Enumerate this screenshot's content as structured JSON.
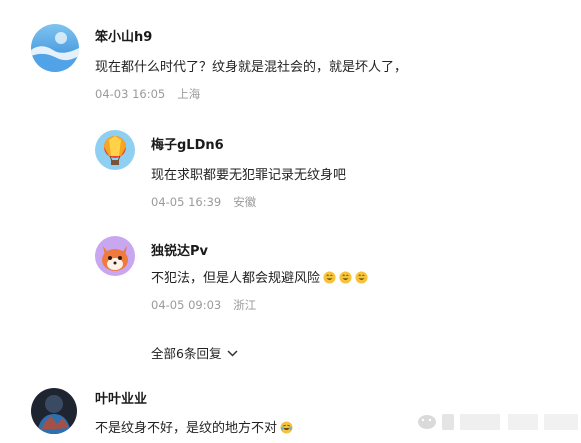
{
  "comments": [
    {
      "username": "笨小山h9",
      "text": "现在都什么时代了？纹身就是混社会的，就是坏人了，",
      "time": "04-03 16:05",
      "location": "上海",
      "avatar_icon": "blue-ocean-avatar"
    },
    {
      "username": "叶叶业业",
      "text": "不是纹身不好，是纹的地方不对",
      "avatar_icon": "dark-scene-avatar"
    }
  ],
  "replies": [
    {
      "username": "梅子gLDn6",
      "text": "现在求职都要无犯罪记录无纹身吧",
      "time": "04-05 16:39",
      "location": "安徽",
      "avatar_icon": "hot-air-balloon-avatar"
    },
    {
      "username": "独锐达Pv",
      "text": "不犯法，但是人都会规避风险",
      "time": "04-05 09:03",
      "location": "浙江",
      "avatar_icon": "fox-cartoon-avatar"
    }
  ],
  "expand_replies_label": "全部6条回复",
  "colors": {
    "username": "#1a1a1a",
    "meta": "#9a9a9a",
    "emoji": "#f5c33b"
  }
}
